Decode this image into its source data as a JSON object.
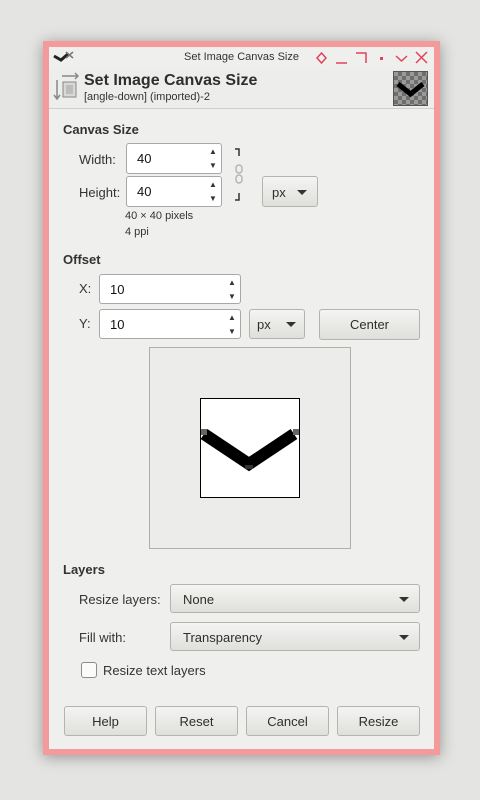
{
  "window": {
    "title": "Set Image Canvas Size"
  },
  "header": {
    "title": "Set Image Canvas Size",
    "subtitle": "[angle-down] (imported)-2"
  },
  "canvas_size": {
    "section_label": "Canvas Size",
    "width_label": "Width:",
    "width_value": "40",
    "height_label": "Height:",
    "height_value": "40",
    "unit": "px",
    "dimensions_info": "40 × 40 pixels",
    "resolution_info": "4 ppi"
  },
  "offset": {
    "section_label": "Offset",
    "x_label": "X:",
    "x_value": "10",
    "y_label": "Y:",
    "y_value": "10",
    "unit": "px",
    "center_label": "Center"
  },
  "layers": {
    "section_label": "Layers",
    "resize_layers_label": "Resize layers:",
    "resize_layers_value": "None",
    "fill_with_label": "Fill with:",
    "fill_with_value": "Transparency",
    "resize_text_layers_label": "Resize text layers",
    "resize_text_layers_checked": false
  },
  "buttons": {
    "help": "Help",
    "reset": "Reset",
    "cancel": "Cancel",
    "resize": "Resize"
  },
  "icons": {
    "app": "gimp-icon",
    "header": "canvas-size-icon",
    "chain": "chain-link-icon",
    "window_controls": [
      "shade-icon",
      "minimize-icon",
      "maximize-icon",
      "sticky-icon",
      "menu-icon",
      "close-icon"
    ]
  },
  "colors": {
    "frame": "#f49a9a",
    "background": "#efefed"
  }
}
